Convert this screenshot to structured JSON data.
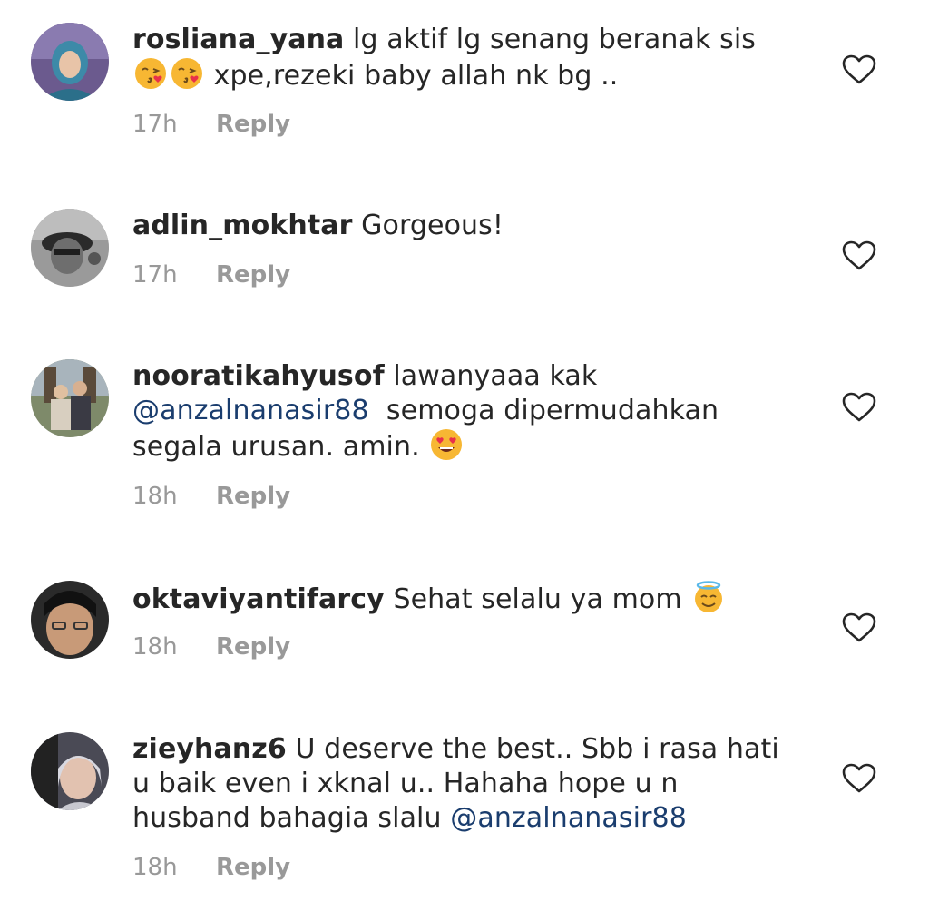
{
  "comments": [
    {
      "username": "rosliana_yana",
      "text_before": "lg aktif lg senang beranak sis",
      "text_after": "xpe,rezeki baby allah nk bg ..",
      "emojis": [
        "kissing-heart-emoji",
        "kissing-heart-emoji"
      ],
      "time": "17h",
      "reply": "Reply"
    },
    {
      "username": "adlin_mokhtar",
      "text": "Gorgeous!",
      "time": "17h",
      "reply": "Reply"
    },
    {
      "username": "nooratikahyusof",
      "text_line1": "lawanyaaa kak",
      "mention": "@anzalnanasir88",
      "text_line2": "semoga dipermudahkan",
      "text_line3": "segala urusan. amin.",
      "emojis": [
        "heart-eyes-emoji"
      ],
      "time": "18h",
      "reply": "Reply"
    },
    {
      "username": "oktaviyantifarcy",
      "text": "Sehat selalu ya mom",
      "emojis": [
        "halo-smile-emoji"
      ],
      "time": "18h",
      "reply": "Reply"
    },
    {
      "username": "zieyhanz6",
      "text_line1": "U deserve the best.. Sbb i rasa hati",
      "text_line2": "u baik even i xknal u.. Hahaha hope u n",
      "text_line3": "husband bahagia slalu",
      "mention": "@anzalnanasir88",
      "time": "18h",
      "reply": "Reply"
    }
  ],
  "colors": {
    "text": "#262626",
    "meta": "#999999",
    "mention": "#1a3d6e"
  },
  "icons": {
    "like": "heart-outline-icon"
  }
}
